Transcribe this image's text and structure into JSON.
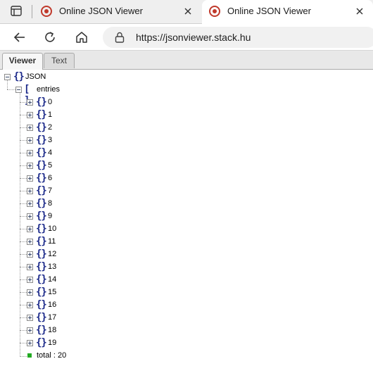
{
  "browser": {
    "tabs": [
      {
        "title": "Online JSON Viewer",
        "active": false
      },
      {
        "title": "Online JSON Viewer",
        "active": true
      }
    ],
    "url": "https://jsonviewer.stack.hu"
  },
  "app": {
    "tabs": [
      {
        "label": "Viewer",
        "active": true
      },
      {
        "label": "Text",
        "active": false
      }
    ]
  },
  "tree": {
    "root": {
      "label": "JSON",
      "type": "object",
      "expanded": true
    },
    "entries": {
      "label": "entries",
      "type": "array",
      "expanded": true
    },
    "items": [
      {
        "label": "0"
      },
      {
        "label": "1"
      },
      {
        "label": "2"
      },
      {
        "label": "3"
      },
      {
        "label": "4"
      },
      {
        "label": "5"
      },
      {
        "label": "6"
      },
      {
        "label": "7"
      },
      {
        "label": "8"
      },
      {
        "label": "9"
      },
      {
        "label": "10"
      },
      {
        "label": "11"
      },
      {
        "label": "12"
      },
      {
        "label": "13"
      },
      {
        "label": "14"
      },
      {
        "label": "15"
      },
      {
        "label": "16"
      },
      {
        "label": "17"
      },
      {
        "label": "18"
      },
      {
        "label": "19"
      }
    ],
    "total": {
      "label": "total : 20"
    }
  },
  "colors": {
    "node_icon": "#1c2a8a",
    "leaf_icon": "#22aa22",
    "favicon": "#c0392b"
  }
}
